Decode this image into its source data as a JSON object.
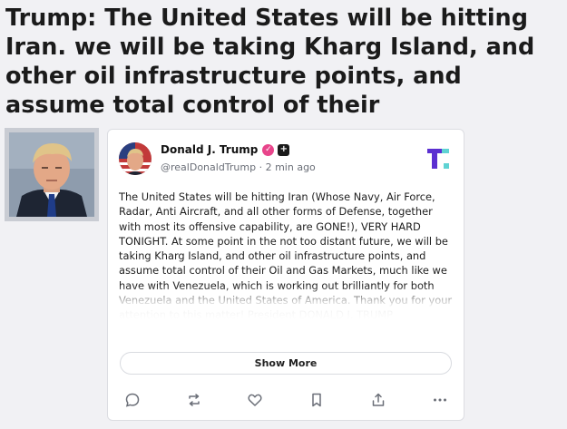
{
  "headline": "Trump: The United States will be hitting Iran. we will be taking Kharg Island, and other oil infrastructure points, and assume total control of their",
  "post": {
    "author_name": "Donald J. Trump",
    "handle": "@realDonaldTrump",
    "separator": " · ",
    "time": "2 min ago",
    "verified_icon": "check",
    "plus_badge": "+",
    "body": "The United States will be hitting Iran (Whose Navy, Air Force, Radar, Anti Aircraft, and all other forms of Defense, together with most its offensive capability, are GONE!), VERY HARD TONIGHT. At some point in the not too distant future, we will be taking Kharg Island, and other oil infrastructure points, and assume total control of their Oil and Gas Markets, much like we have with Venezuela, which is working out brilliantly for both Venezuela and the United States of America. Thank you for your attention to this matter! President DONALD J. TRUMP",
    "show_more_label": "Show More"
  },
  "actions": [
    {
      "name": "reply",
      "icon": "comment-icon"
    },
    {
      "name": "retruth",
      "icon": "repost-icon"
    },
    {
      "name": "like",
      "icon": "heart-icon"
    },
    {
      "name": "bookmark",
      "icon": "bookmark-icon"
    },
    {
      "name": "share",
      "icon": "share-icon"
    },
    {
      "name": "more",
      "icon": "more-icon"
    }
  ],
  "colors": {
    "verified": "#e8458b",
    "brand_teal": "#5fd3d3",
    "brand_purple": "#5b2fd1",
    "icon": "#6b6f78"
  }
}
